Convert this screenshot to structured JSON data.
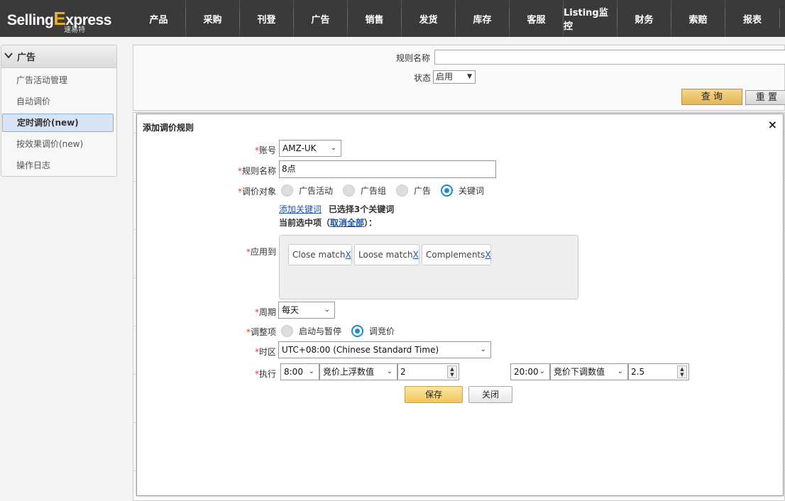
{
  "brand": {
    "name_left": "Selling",
    "name_x": "E",
    "name_right": "xpress",
    "sub": "速易特"
  },
  "nav": [
    "产品",
    "采购",
    "刊登",
    "广告",
    "销售",
    "发货",
    "库存",
    "客服",
    "Listing监控",
    "财务",
    "索赔",
    "报表"
  ],
  "sidebar": {
    "title": "广告",
    "items": [
      {
        "label": "广告活动管理",
        "active": false
      },
      {
        "label": "自动调价",
        "active": false
      },
      {
        "label": "定时调价(new)",
        "active": true
      },
      {
        "label": "按效果调价(new)",
        "active": false
      },
      {
        "label": "操作日志",
        "active": false
      }
    ]
  },
  "search": {
    "rule_name_label": "规则名称",
    "status_label": "状态",
    "status_value": "启用",
    "query_button": "查 询",
    "reset_button": "重 置"
  },
  "modal": {
    "title": "添加调价规则",
    "close": "×",
    "account_label": "账号",
    "account_value": "AMZ-UK",
    "rule_name_label": "规则名称",
    "rule_name_value": "8点",
    "target_label": "调价对象",
    "target_options": [
      {
        "label": "广告活动",
        "checked": false
      },
      {
        "label": "广告组",
        "checked": false
      },
      {
        "label": "广告",
        "checked": false
      },
      {
        "label": "关键词",
        "checked": true
      }
    ],
    "add_keyword_link": "添加关键词",
    "selected_info": "已选择3个关键词",
    "current_prefix": "当前选中项（",
    "cancel_all_link": "取消全部",
    "current_suffix": "）：",
    "apply_label": "应用到",
    "chips": [
      {
        "label": "Close match",
        "x": "X"
      },
      {
        "label": "Loose match",
        "x": "X"
      },
      {
        "label": "Complements",
        "x": "X"
      }
    ],
    "period_label": "周期",
    "period_value": "每天",
    "adjust_label": "调整项",
    "adjust_options": [
      {
        "label": "启动与暂停",
        "checked": false
      },
      {
        "label": "调竞价",
        "checked": true
      }
    ],
    "timezone_label": "时区",
    "timezone_value": "UTC+08:00 (Chinese Standard Time)",
    "exec_label": "执行",
    "exec1": {
      "time": "8:00",
      "mode": "竞价上浮数值",
      "value": "2"
    },
    "exec2": {
      "time": "20:00",
      "mode": "竞价下调数值",
      "value": "2.5"
    },
    "save_button": "保存",
    "close_button": "关闭"
  },
  "required_mark": "*"
}
